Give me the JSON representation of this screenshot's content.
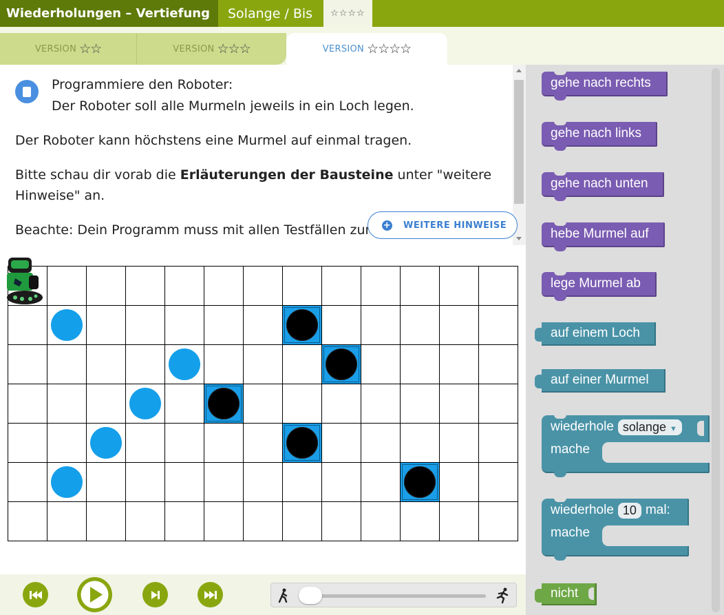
{
  "header": {
    "title": "Wiederholungen – Vertiefung",
    "subtitle": "Solange / Bis",
    "stars": "☆☆☆☆"
  },
  "tabs": [
    {
      "label": "VERSION",
      "stars": "☆☆"
    },
    {
      "label": "VERSION",
      "stars": "☆☆☆"
    },
    {
      "label": "VERSION",
      "stars": "☆☆☆☆"
    }
  ],
  "description": {
    "line1": "Programmiere den Roboter:",
    "line2": "Der Roboter soll alle Murmeln jeweils in ein Loch legen.",
    "para1": "Der Roboter kann höchstens eine Murmel auf einmal tragen.",
    "para2_pre": "Bitte schau dir vorab die ",
    "para2_bold": "Erläuterungen der Bausteine",
    "para2_post": " unter \"weitere",
    "para2_line2": "Hinweise\" an.",
    "para3": "Beachte: Dein Programm muss mit allen Testfällen zure"
  },
  "hint_button": {
    "label": "WEITERE HINWEISE"
  },
  "grid": {
    "cols": 13,
    "rows": 7,
    "holes": [
      [
        1,
        7
      ],
      [
        2,
        8
      ],
      [
        3,
        5
      ],
      [
        4,
        7
      ],
      [
        5,
        10
      ]
    ],
    "marbles": [
      [
        1,
        1
      ],
      [
        2,
        4
      ],
      [
        3,
        3
      ],
      [
        4,
        2
      ],
      [
        5,
        1
      ]
    ],
    "robot": [
      0,
      0
    ]
  },
  "controls": {
    "speed_min_icon": "walk-icon",
    "speed_max_icon": "run-icon",
    "speed_value": 0.0
  },
  "toolbox": {
    "blocks": [
      {
        "label": "gehe nach rechts",
        "color": "#7a5cb2"
      },
      {
        "label": "gehe nach links",
        "color": "#7a5cb2"
      },
      {
        "label": "gehe nach unten",
        "color": "#7a5cb2"
      },
      {
        "label": "hebe Murmel auf",
        "color": "#7a5cb2"
      },
      {
        "label": "lege Murmel ab",
        "color": "#7a5cb2"
      },
      {
        "label": "auf einem Loch",
        "color": "#4a93a7"
      },
      {
        "label": "auf einer Murmel",
        "color": "#4a93a7"
      }
    ],
    "while_block": {
      "label": "wiederhole",
      "option": "solange",
      "do": "mache"
    },
    "repeat_block": {
      "label": "wiederhole",
      "count": "10",
      "suffix": "mal:",
      "do": "mache"
    },
    "not_block": {
      "label": "nicht"
    }
  }
}
